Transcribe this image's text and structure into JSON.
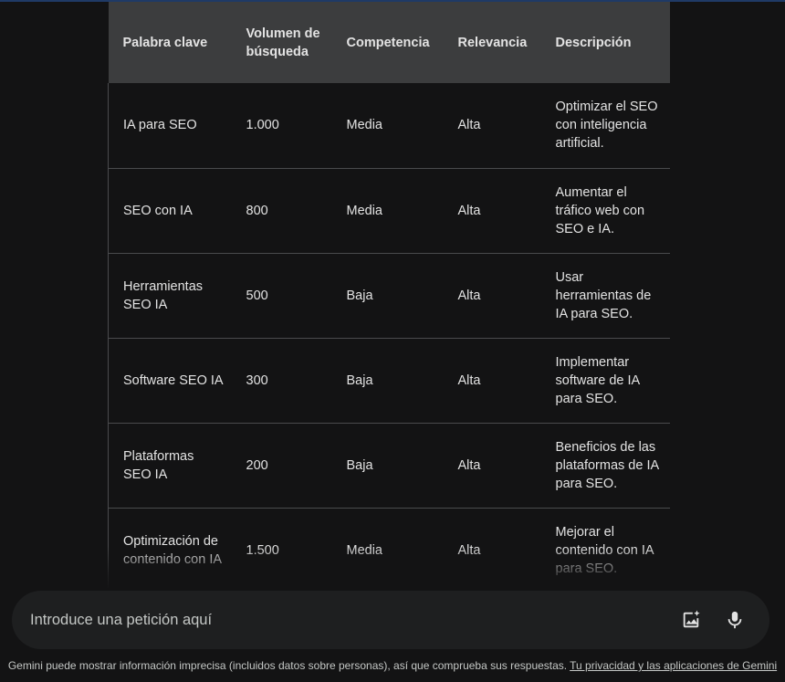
{
  "table": {
    "headers": [
      "Palabra clave",
      "Volumen de búsqueda",
      "Competencia",
      "Relevancia",
      "Descripción"
    ],
    "rows": [
      [
        "IA para SEO",
        "1.000",
        "Media",
        "Alta",
        "Optimizar el SEO con inteligencia artificial."
      ],
      [
        "SEO con IA",
        "800",
        "Media",
        "Alta",
        "Aumentar el tráfico web con SEO e IA."
      ],
      [
        "Herramientas SEO IA",
        "500",
        "Baja",
        "Alta",
        "Usar herramientas de IA para SEO."
      ],
      [
        "Software SEO IA",
        "300",
        "Baja",
        "Alta",
        "Implementar software de IA para SEO."
      ],
      [
        "Plataformas SEO IA",
        "200",
        "Baja",
        "Alta",
        "Beneficios de las plataformas de IA para SEO."
      ],
      [
        "Optimización de contenido con IA",
        "1.500",
        "Media",
        "Alta",
        "Mejorar el contenido con IA para SEO."
      ]
    ]
  },
  "input": {
    "placeholder": "Introduce una petición aquí",
    "image_button_icon": "add-image-icon",
    "mic_button_icon": "microphone-icon"
  },
  "footer": {
    "text": "Gemini puede mostrar información imprecisa (incluidos datos sobre personas), así que comprueba sus respuestas.",
    "link": "Tu privacidad y las aplicaciones de Gemini"
  },
  "colors": {
    "background": "#131314",
    "header_bg": "#3c3d3e",
    "input_bg": "#1e1f20",
    "text": "#e3e3e3"
  }
}
